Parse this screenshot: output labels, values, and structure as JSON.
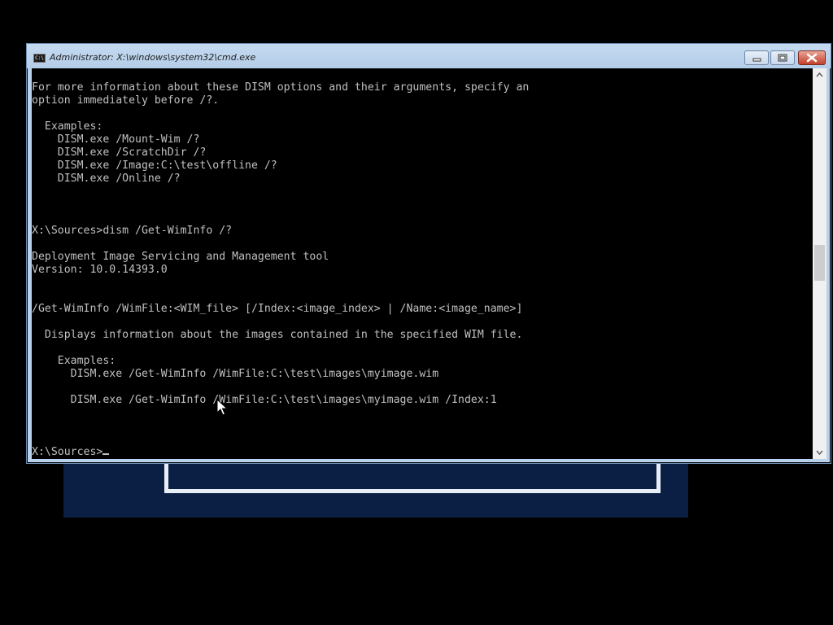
{
  "window": {
    "title": "Administrator: X:\\windows\\system32\\cmd.exe",
    "icon": "cmd-icon",
    "icon_text": "C:\\"
  },
  "console": {
    "lines": [
      "For more information about these DISM options and their arguments, specify an",
      "option immediately before /?.",
      "",
      "  Examples:",
      "    DISM.exe /Mount-Wim /?",
      "    DISM.exe /ScratchDir /?",
      "    DISM.exe /Image:C:\\test\\offline /?",
      "    DISM.exe /Online /?",
      "",
      "",
      "",
      "X:\\Sources>dism /Get-WimInfo /?",
      "",
      "Deployment Image Servicing and Management tool",
      "Version: 10.0.14393.0",
      "",
      "",
      "/Get-WimInfo /WimFile:<WIM_file> [/Index:<image_index> | /Name:<image_name>]",
      "",
      "  Displays information about the images contained in the specified WIM file.",
      "",
      "    Examples:",
      "      DISM.exe /Get-WimInfo /WimFile:C:\\test\\images\\myimage.wim",
      "",
      "      DISM.exe /Get-WimInfo /WimFile:C:\\test\\images\\myimage.wim /Index:1",
      "",
      "",
      "",
      "X:\\Sources>"
    ]
  },
  "colors": {
    "console_bg": "#000000",
    "console_text": "#c0c0c0",
    "titlebar": "#b9d1ea",
    "close_button": "#c2402a"
  }
}
